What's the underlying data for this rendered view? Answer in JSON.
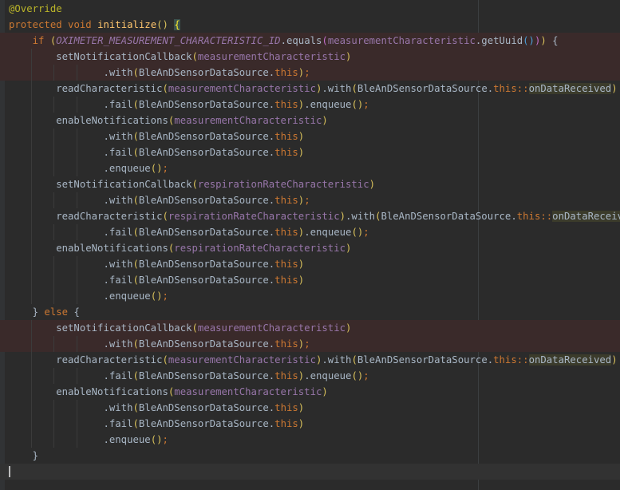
{
  "editor": {
    "lines": [
      "@Override",
      "protected void initialize() {",
      "    if (OXIMETER_MEASUREMENT_CHARACTERISTIC_ID.equals(measurementCharacteristic.getUuid())) {",
      "        setNotificationCallback(measurementCharacteristic)",
      "                .with(BleAnDSensorDataSource.this);",
      "        readCharacteristic(measurementCharacteristic).with(BleAnDSensorDataSource.this::onDataReceived)",
      "                .fail(BleAnDSensorDataSource.this).enqueue();",
      "        enableNotifications(measurementCharacteristic)",
      "                .with(BleAnDSensorDataSource.this)",
      "                .fail(BleAnDSensorDataSource.this)",
      "                .enqueue();",
      "        setNotificationCallback(respirationRateCharacteristic)",
      "                .with(BleAnDSensorDataSource.this);",
      "        readCharacteristic(respirationRateCharacteristic).with(BleAnDSensorDataSource.this::onDataReceived)",
      "                .fail(BleAnDSensorDataSource.this).enqueue();",
      "        enableNotifications(respirationRateCharacteristic)",
      "                .with(BleAnDSensorDataSource.this)",
      "                .fail(BleAnDSensorDataSource.this)",
      "                .enqueue();",
      "    } else {",
      "        setNotificationCallback(measurementCharacteristic)",
      "                .with(BleAnDSensorDataSource.this);",
      "        readCharacteristic(measurementCharacteristic).with(BleAnDSensorDataSource.this::onDataReceived)",
      "                .fail(BleAnDSensorDataSource.this).enqueue();",
      "        enableNotifications(measurementCharacteristic)",
      "                .with(BleAnDSensorDataSource.this)",
      "                .fail(BleAnDSensorDataSource.this)",
      "                .enqueue();",
      "    }",
      ""
    ],
    "highlighted_lines": [
      2,
      3,
      4,
      20,
      21
    ],
    "current_line": 29,
    "colors": {
      "background": "#2b2b2b",
      "default_text": "#a9b7c6",
      "keyword": "#cc7832",
      "annotation": "#bbb529",
      "method_declaration": "#ffc66d",
      "field": "#9876aa",
      "highlight_row": "#3a2a2a"
    }
  }
}
